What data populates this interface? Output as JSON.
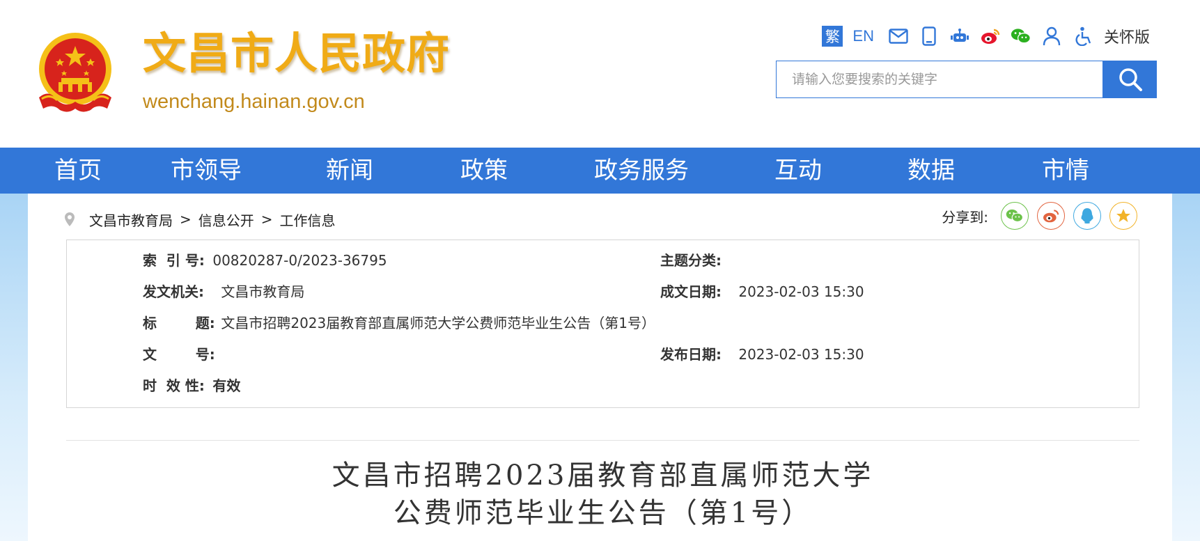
{
  "site": {
    "title": "文昌市人民政府",
    "domain": "wenchang.hainan.gov.cn"
  },
  "toolbar": {
    "traditional_label": "繁",
    "english_label": "EN",
    "care_label": "关怀版",
    "icons": [
      "mail-icon",
      "mobile-icon",
      "robot-icon",
      "weibo-icon",
      "wechat-icon",
      "user-icon",
      "accessibility-icon"
    ]
  },
  "search": {
    "placeholder": "请输入您要搜索的关键字"
  },
  "nav": {
    "items": [
      "首页",
      "市领导",
      "新闻",
      "政策",
      "政务服务",
      "互动",
      "数据",
      "市情"
    ]
  },
  "breadcrumb": {
    "items": [
      "文昌市教育局",
      "信息公开",
      "工作信息"
    ],
    "separator": ">"
  },
  "share": {
    "label": "分享到:",
    "targets": [
      "wechat",
      "weibo",
      "qq",
      "qzone"
    ]
  },
  "meta": {
    "index_label": "索  引 号:",
    "index_value": "00820287-0/2023-36795",
    "topic_label": "主题分类:",
    "topic_value": "",
    "issuer_label": "发文机关:",
    "issuer_value": "文昌市教育局",
    "created_label": "成文日期:",
    "created_value": "2023-02-03 15:30",
    "title_label": "标        题:",
    "title_value": "文昌市招聘2023届教育部直属师范大学公费师范毕业生公告（第1号）",
    "docno_label": "文        号:",
    "docno_value": "",
    "published_label": "发布日期:",
    "published_value": "2023-02-03 15:30",
    "validity_label": "时  效 性:",
    "validity_value": "有效"
  },
  "article": {
    "title_line1": "文昌市招聘2023届教育部直属师范大学",
    "title_line2": "公费师范毕业生公告（第1号）"
  },
  "colors": {
    "brand_blue": "#3277d8",
    "title_gold": "#f0ab16",
    "emblem_red": "#d7231c",
    "emblem_gold": "#f5c018"
  }
}
